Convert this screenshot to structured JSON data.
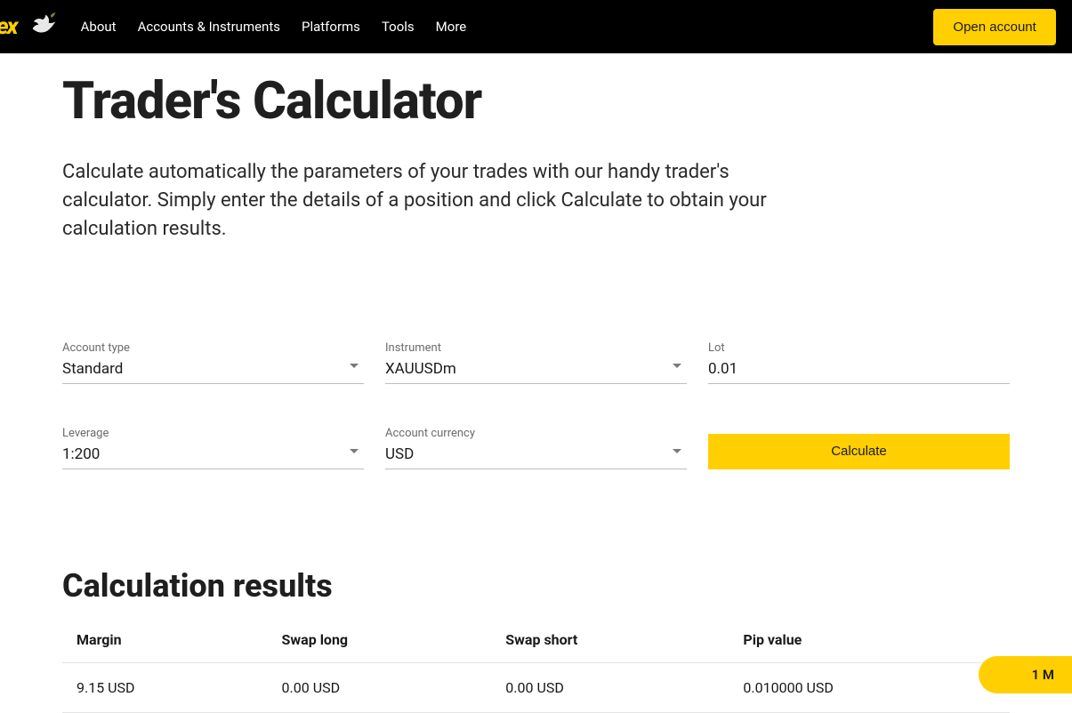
{
  "nav": {
    "items": [
      "About",
      "Accounts & Instruments",
      "Platforms",
      "Tools",
      "More"
    ],
    "open_account": "Open account"
  },
  "page": {
    "title": "Trader's Calculator",
    "subtitle": "Calculate automatically the parameters of your trades with our handy trader's calculator. Simply enter the details of a position and click Calculate to obtain your calculation results."
  },
  "form": {
    "account_type": {
      "label": "Account type",
      "value": "Standard"
    },
    "instrument": {
      "label": "Instrument",
      "value": "XAUUSDm"
    },
    "lot": {
      "label": "Lot",
      "value": "0.01"
    },
    "leverage": {
      "label": "Leverage",
      "value": "1:200"
    },
    "currency": {
      "label": "Account currency",
      "value": "USD"
    },
    "calculate_label": "Calculate"
  },
  "results": {
    "title": "Calculation results",
    "headers": [
      "Margin",
      "Swap long",
      "Swap short",
      "Pip value"
    ],
    "row": [
      "9.15 USD",
      "0.00 USD",
      "0.00 USD",
      "0.010000 USD"
    ]
  },
  "pill": {
    "label": "1 M"
  }
}
